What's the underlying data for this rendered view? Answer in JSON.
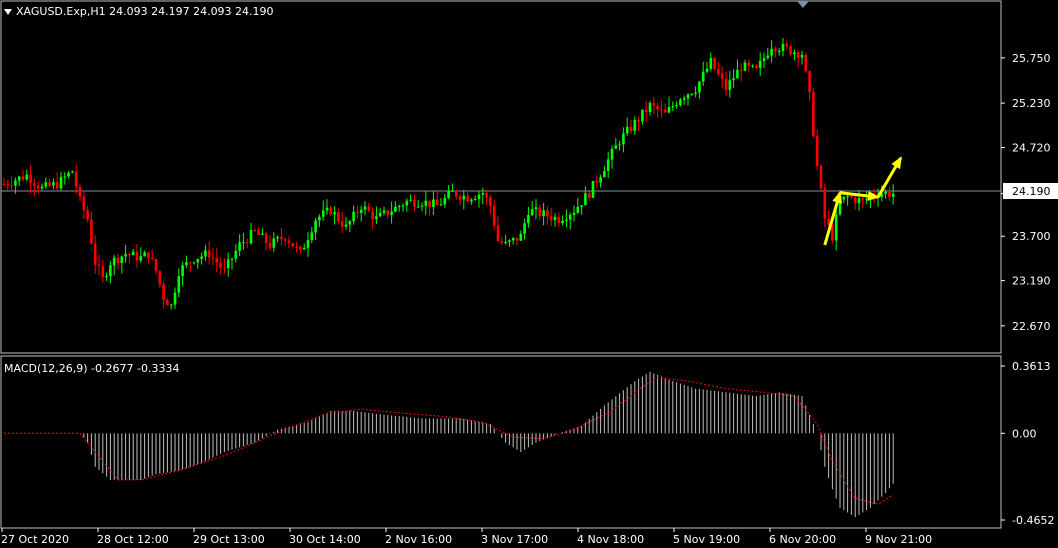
{
  "header": {
    "symbol_line": "XAGUSD.Exp,H1  24.093 24.197 24.093 24.190"
  },
  "macd_header": {
    "label": "MACD(12,26,9) -0.2677 -0.3334"
  },
  "colors": {
    "background": "#000000",
    "bull": "#00ff00",
    "bear": "#ff0000",
    "axis": "#ffffff",
    "arrows": "#ffff00",
    "signal_line": "#ff0000",
    "histogram": "#c0c0c0"
  },
  "chart_data": [
    {
      "type": "candlestick",
      "title": "XAGUSD.Exp,H1",
      "ylim": [
        22.45,
        26.3
      ],
      "y_ticks": [
        "25.750",
        "25.230",
        "24.720",
        "24.190",
        "23.700",
        "23.190",
        "22.670"
      ],
      "current_price": "24.190",
      "x_ticks": [
        "27 Oct 2020",
        "28 Oct 12:00",
        "29 Oct 13:00",
        "30 Oct 14:00",
        "2 Nov 16:00",
        "3 Nov 17:00",
        "4 Nov 18:00",
        "5 Nov 19:00",
        "6 Nov 20:00",
        "9 Nov 21:00"
      ],
      "close_path": [
        [
          0,
          24.3
        ],
        [
          6,
          24.4
        ],
        [
          10,
          24.25
        ],
        [
          14,
          24.3
        ],
        [
          18,
          24.45
        ],
        [
          20,
          24.1
        ],
        [
          22,
          23.9
        ],
        [
          24,
          23.4
        ],
        [
          26,
          23.2
        ],
        [
          28,
          23.4
        ],
        [
          32,
          23.5
        ],
        [
          36,
          23.45
        ],
        [
          38,
          23.5
        ],
        [
          40,
          23.3
        ],
        [
          42,
          23.0
        ],
        [
          44,
          22.9
        ],
        [
          46,
          23.3
        ],
        [
          50,
          23.45
        ],
        [
          54,
          23.5
        ],
        [
          58,
          23.3
        ],
        [
          62,
          23.6
        ],
        [
          66,
          23.75
        ],
        [
          70,
          23.6
        ],
        [
          74,
          23.7
        ],
        [
          78,
          23.5
        ],
        [
          82,
          23.9
        ],
        [
          86,
          24.0
        ],
        [
          90,
          23.8
        ],
        [
          94,
          24.05
        ],
        [
          98,
          23.9
        ],
        [
          102,
          24.0
        ],
        [
          106,
          24.1
        ],
        [
          110,
          24.1
        ],
        [
          114,
          24.05
        ],
        [
          118,
          24.2
        ],
        [
          122,
          24.15
        ],
        [
          126,
          24.2
        ],
        [
          128,
          24.05
        ],
        [
          130,
          23.65
        ],
        [
          132,
          23.6
        ],
        [
          136,
          23.7
        ],
        [
          138,
          24.0
        ],
        [
          142,
          23.95
        ],
        [
          146,
          23.9
        ],
        [
          150,
          24.0
        ],
        [
          154,
          24.2
        ],
        [
          158,
          24.5
        ],
        [
          162,
          24.8
        ],
        [
          166,
          25.0
        ],
        [
          170,
          25.2
        ],
        [
          174,
          25.1
        ],
        [
          178,
          25.3
        ],
        [
          182,
          25.4
        ],
        [
          186,
          25.7
        ],
        [
          190,
          25.4
        ],
        [
          194,
          25.65
        ],
        [
          198,
          25.6
        ],
        [
          202,
          25.9
        ],
        [
          206,
          25.85
        ],
        [
          210,
          25.8
        ],
        [
          212,
          25.3
        ],
        [
          214,
          24.5
        ],
        [
          216,
          23.9
        ],
        [
          218,
          23.7
        ],
        [
          220,
          24.1
        ],
        [
          222,
          24.15
        ],
        [
          226,
          24.1
        ],
        [
          230,
          24.2
        ],
        [
          234,
          24.19
        ]
      ],
      "current_arrows": [
        [
          [
            216,
            23.6
          ],
          [
            220,
            24.2
          ]
        ],
        [
          [
            220,
            24.2
          ],
          [
            230,
            24.15
          ]
        ],
        [
          [
            230,
            24.15
          ],
          [
            236,
            24.6
          ]
        ]
      ]
    },
    {
      "type": "histogram",
      "title": "MACD(12,26,9)",
      "ylim": [
        -0.4652,
        0.3613
      ],
      "y_ticks": [
        "0.3613",
        "0.00",
        "-0.4652"
      ],
      "macd_value": -0.2677,
      "signal_value": -0.3334,
      "histogram_path": [
        [
          0,
          0
        ],
        [
          20,
          0
        ],
        [
          22,
          -0.05
        ],
        [
          24,
          -0.18
        ],
        [
          28,
          -0.25
        ],
        [
          32,
          -0.25
        ],
        [
          36,
          -0.25
        ],
        [
          40,
          -0.22
        ],
        [
          46,
          -0.2
        ],
        [
          52,
          -0.16
        ],
        [
          58,
          -0.1
        ],
        [
          66,
          -0.05
        ],
        [
          72,
          0.02
        ],
        [
          80,
          0.06
        ],
        [
          86,
          0.12
        ],
        [
          92,
          0.12
        ],
        [
          100,
          0.1
        ],
        [
          110,
          0.08
        ],
        [
          120,
          0.08
        ],
        [
          128,
          0.05
        ],
        [
          132,
          -0.05
        ],
        [
          136,
          -0.1
        ],
        [
          140,
          -0.05
        ],
        [
          146,
          0.0
        ],
        [
          152,
          0.04
        ],
        [
          158,
          0.15
        ],
        [
          166,
          0.28
        ],
        [
          170,
          0.33
        ],
        [
          176,
          0.28
        ],
        [
          182,
          0.24
        ],
        [
          190,
          0.22
        ],
        [
          198,
          0.2
        ],
        [
          204,
          0.22
        ],
        [
          210,
          0.2
        ],
        [
          214,
          0.0
        ],
        [
          216,
          -0.18
        ],
        [
          218,
          -0.3
        ],
        [
          220,
          -0.4
        ],
        [
          224,
          -0.45
        ],
        [
          228,
          -0.4
        ],
        [
          232,
          -0.32
        ],
        [
          234,
          -0.27
        ]
      ],
      "signal_path": [
        [
          0,
          0
        ],
        [
          20,
          0
        ],
        [
          24,
          -0.1
        ],
        [
          30,
          -0.25
        ],
        [
          36,
          -0.25
        ],
        [
          46,
          -0.2
        ],
        [
          58,
          -0.12
        ],
        [
          66,
          -0.05
        ],
        [
          74,
          0.02
        ],
        [
          84,
          0.1
        ],
        [
          94,
          0.13
        ],
        [
          104,
          0.11
        ],
        [
          116,
          0.09
        ],
        [
          126,
          0.06
        ],
        [
          134,
          -0.02
        ],
        [
          142,
          -0.03
        ],
        [
          150,
          0.02
        ],
        [
          160,
          0.12
        ],
        [
          168,
          0.25
        ],
        [
          172,
          0.3
        ],
        [
          180,
          0.28
        ],
        [
          190,
          0.24
        ],
        [
          200,
          0.22
        ],
        [
          208,
          0.2
        ],
        [
          214,
          0.05
        ],
        [
          218,
          -0.15
        ],
        [
          224,
          -0.35
        ],
        [
          230,
          -0.38
        ],
        [
          234,
          -0.33
        ]
      ]
    }
  ]
}
